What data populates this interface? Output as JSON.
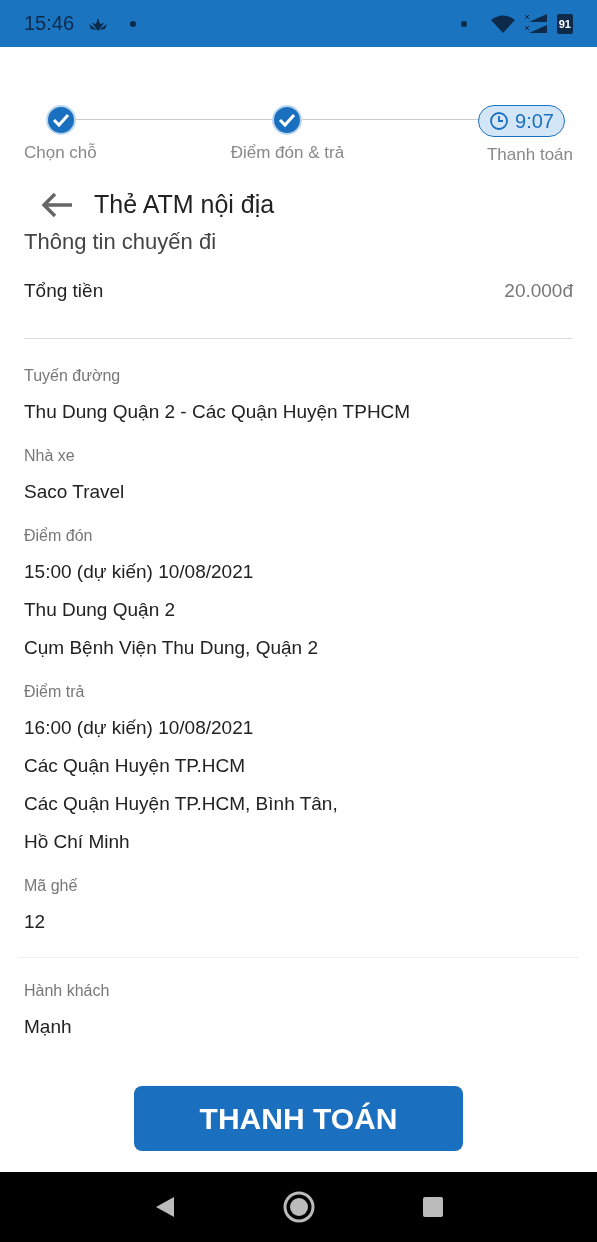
{
  "status_bar": {
    "time": "15:46",
    "battery": "91"
  },
  "steps": [
    {
      "label": "Chọn chỗ",
      "kind": "done"
    },
    {
      "label": "Điểm đón & trả",
      "kind": "done"
    },
    {
      "label": "Thanh toán",
      "kind": "timer",
      "timer": "9:07"
    }
  ],
  "header": {
    "title": "Thẻ ATM nội địa"
  },
  "subtitle": "Thông tin chuyến đi",
  "total": {
    "label": "Tổng tiền",
    "value": "20.000đ"
  },
  "sections": [
    {
      "label": "Tuyến đường",
      "lines": [
        "Thu Dung Quận 2 - Các Quận Huyện TPHCM"
      ]
    },
    {
      "label": "Nhà xe",
      "lines": [
        "Saco Travel"
      ]
    },
    {
      "label": "Điểm đón",
      "lines": [
        "15:00 (dự kiến) 10/08/2021",
        "Thu Dung Quận 2",
        "Cụm Bệnh Viện Thu Dung, Quận 2"
      ]
    },
    {
      "label": "Điểm trả",
      "lines": [
        "16:00 (dự kiến) 10/08/2021",
        "Các Quận Huyện TP.HCM",
        "Các Quận Huyện TP.HCM, Bình Tân,",
        "Hồ Chí Minh"
      ]
    },
    {
      "label": "Mã ghế",
      "lines": [
        "12"
      ]
    }
  ],
  "passenger": {
    "label": "Hành khách",
    "lines": [
      "Mạnh"
    ]
  },
  "pay_button": "THANH TOÁN"
}
